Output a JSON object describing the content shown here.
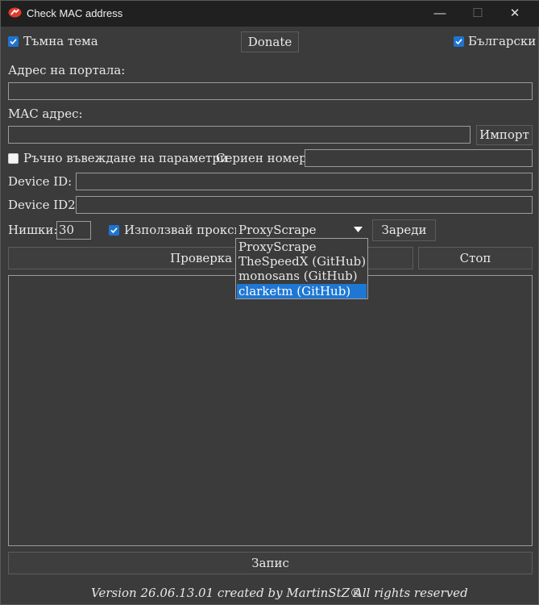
{
  "window": {
    "title": "Check MAC address",
    "controls": {
      "minimize": "—",
      "maximize": "☐",
      "close": "✕"
    }
  },
  "top": {
    "dark_theme": {
      "label": "Тъмна тема",
      "checked": true
    },
    "donate_label": "Donate",
    "language": {
      "label": "Български",
      "checked": true
    }
  },
  "portal": {
    "label": "Адрес на портала:",
    "value": ""
  },
  "mac": {
    "label": "MAC адрес:",
    "value": "",
    "import_label": "Импорт"
  },
  "manual": {
    "label": "Ръчно въвеждане на параметри",
    "checked": false
  },
  "serial": {
    "label": "Сериен номер:",
    "value": ""
  },
  "device_id": {
    "label": "Device ID:",
    "value": ""
  },
  "device_id2": {
    "label": "Device ID2:",
    "value": ""
  },
  "threads": {
    "label": "Нишки:",
    "value": "30"
  },
  "proxy": {
    "label": "Използвай прокси",
    "checked": true,
    "selected": "ProxyScrape",
    "options": [
      "ProxyScrape",
      "TheSpeedX (GitHub)",
      "monosans (GitHub)",
      "clarketm (GitHub)"
    ],
    "highlighted_option": "clarketm (GitHub)",
    "load_label": "Зареди"
  },
  "actions": {
    "check_label": "Проверка на",
    "stop_label": "Стоп"
  },
  "output": {
    "text": ""
  },
  "save_label": "Запис",
  "footer": {
    "version": "Version 26.06.13.01 created by MartinStZ®",
    "rights": "All rights reserved"
  },
  "colors": {
    "accent": "#1f74d2",
    "window_bg": "#3b3b3b",
    "titlebar_bg": "#202020",
    "selection": "#1e77d3"
  }
}
